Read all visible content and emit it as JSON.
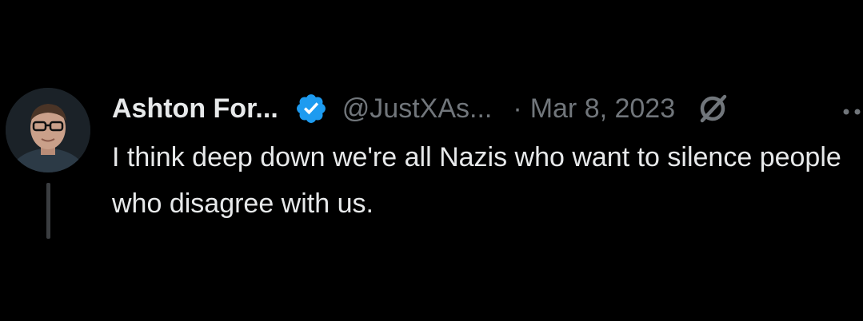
{
  "tweet": {
    "author_name": "Ashton For...",
    "handle": "@JustXAs...",
    "separator": "·",
    "date": "Mar 8, 2023",
    "text": "I think deep down we're all Nazis who want to silence people who disagree with us."
  },
  "icons": {
    "verified": "verified-badge-icon",
    "grok": "grok-icon",
    "more": "more-options-icon"
  },
  "colors": {
    "background": "#000000",
    "primary_text": "#e7e9ea",
    "secondary_text": "#71767b",
    "verified_blue": "#1d9bf0",
    "thread_line": "#3a3d40"
  }
}
